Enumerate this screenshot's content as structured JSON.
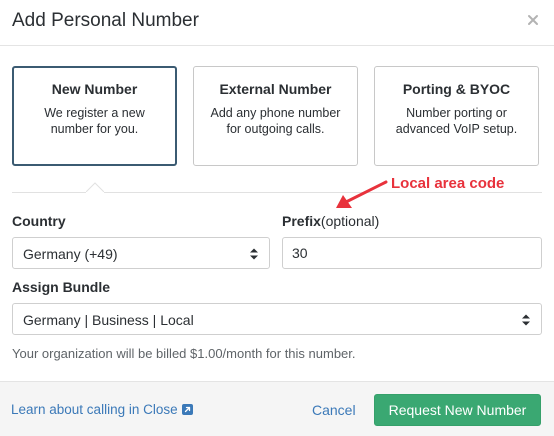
{
  "modal": {
    "title": "Add Personal Number"
  },
  "options": [
    {
      "title": "New Number",
      "description": "We register a new number for you.",
      "selected": true
    },
    {
      "title": "External Number",
      "description": "Add any phone number for outgoing calls.",
      "selected": false
    },
    {
      "title": "Porting & BYOC",
      "description": "Number porting or advanced VoIP setup.",
      "selected": false
    }
  ],
  "annotation": {
    "text": "Local area code",
    "color": "#e8323c"
  },
  "form": {
    "country": {
      "label": "Country",
      "value": "Germany (+49)"
    },
    "prefix": {
      "label": "Prefix",
      "optional": "(optional)",
      "value": "30"
    },
    "bundle": {
      "label": "Assign Bundle",
      "value": "Germany | Business | Local"
    },
    "billing_note": "Your organization will be billed $1.00/month for this number."
  },
  "footer": {
    "learn_link": "Learn about calling in Close",
    "cancel_label": "Cancel",
    "submit_label": "Request New Number"
  },
  "colors": {
    "primary": "#3aa872",
    "link": "#3b79b8",
    "selected_border": "#3b5b72"
  },
  "icons": {
    "close": "close-icon",
    "select": "select-arrows-icon",
    "external": "external-link-icon"
  }
}
